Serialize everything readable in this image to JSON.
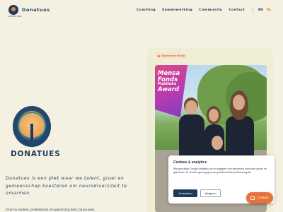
{
  "header": {
    "brand": "Donatues",
    "logo_sub": "DONATUES",
    "nav": [
      "Coaching",
      "Samenwerking",
      "Community",
      "Contact"
    ],
    "lang_en": "EN",
    "lang_nl": "NL"
  },
  "hero": {
    "pill": "Samenwerking",
    "award_line1": "Mensa",
    "award_line2": "Fonds",
    "award_line3": "Publieks",
    "award_line4": "Award",
    "emblem_name": "DONATUES",
    "tagline": "Donatues is een plek waar we talent, groei en gemeenschap koesteren om neurodiversiteit te omarmen.",
    "intro": "Of je nu student, professional of ouders/zorg bent, bij jou past..."
  },
  "cookie": {
    "title": "Cookies & analytics",
    "text": "We gebruiken Google Analytics om te begrijpen hoe bezoekers deze site vinden en gebruiken. Er worden geen gegevens gedeeld totdat je akkoord gaat.",
    "accept": "Accepteren",
    "decline": "Weigeren"
  },
  "fab": {
    "label": "Contact",
    "icon": "chat-icon"
  },
  "colors": {
    "accent": "#e8703a",
    "navy": "#1f3b5c",
    "background": "#f4f1e2"
  }
}
